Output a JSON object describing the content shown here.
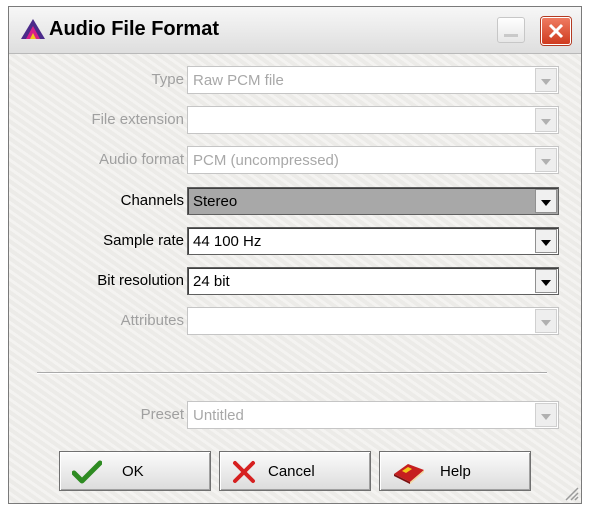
{
  "window": {
    "title": "Audio File Format"
  },
  "form": {
    "rows": [
      {
        "label": "Type",
        "value": "Raw PCM file",
        "enabled": false
      },
      {
        "label": "File extension",
        "value": "",
        "enabled": false
      },
      {
        "label": "Audio format",
        "value": "PCM (uncompressed)",
        "enabled": false
      },
      {
        "label": "Channels",
        "value": "Stereo",
        "enabled": true,
        "focused": true
      },
      {
        "label": "Sample rate",
        "value": "44 100 Hz",
        "enabled": true
      },
      {
        "label": "Bit resolution",
        "value": "24 bit",
        "enabled": true
      },
      {
        "label": "Attributes",
        "value": "",
        "enabled": false
      }
    ],
    "preset": {
      "label": "Preset",
      "value": "Untitled",
      "enabled": false
    }
  },
  "buttons": {
    "ok": {
      "label": "OK",
      "icon": "checkmark-icon"
    },
    "cancel": {
      "label": "Cancel",
      "icon": "x-icon"
    },
    "help": {
      "label": "Help",
      "icon": "book-icon"
    }
  },
  "colors": {
    "ok_check": "#2e8b22",
    "cancel_x": "#d62020",
    "close_button": "#d9472b",
    "focused_field": "#a8a8a8"
  }
}
